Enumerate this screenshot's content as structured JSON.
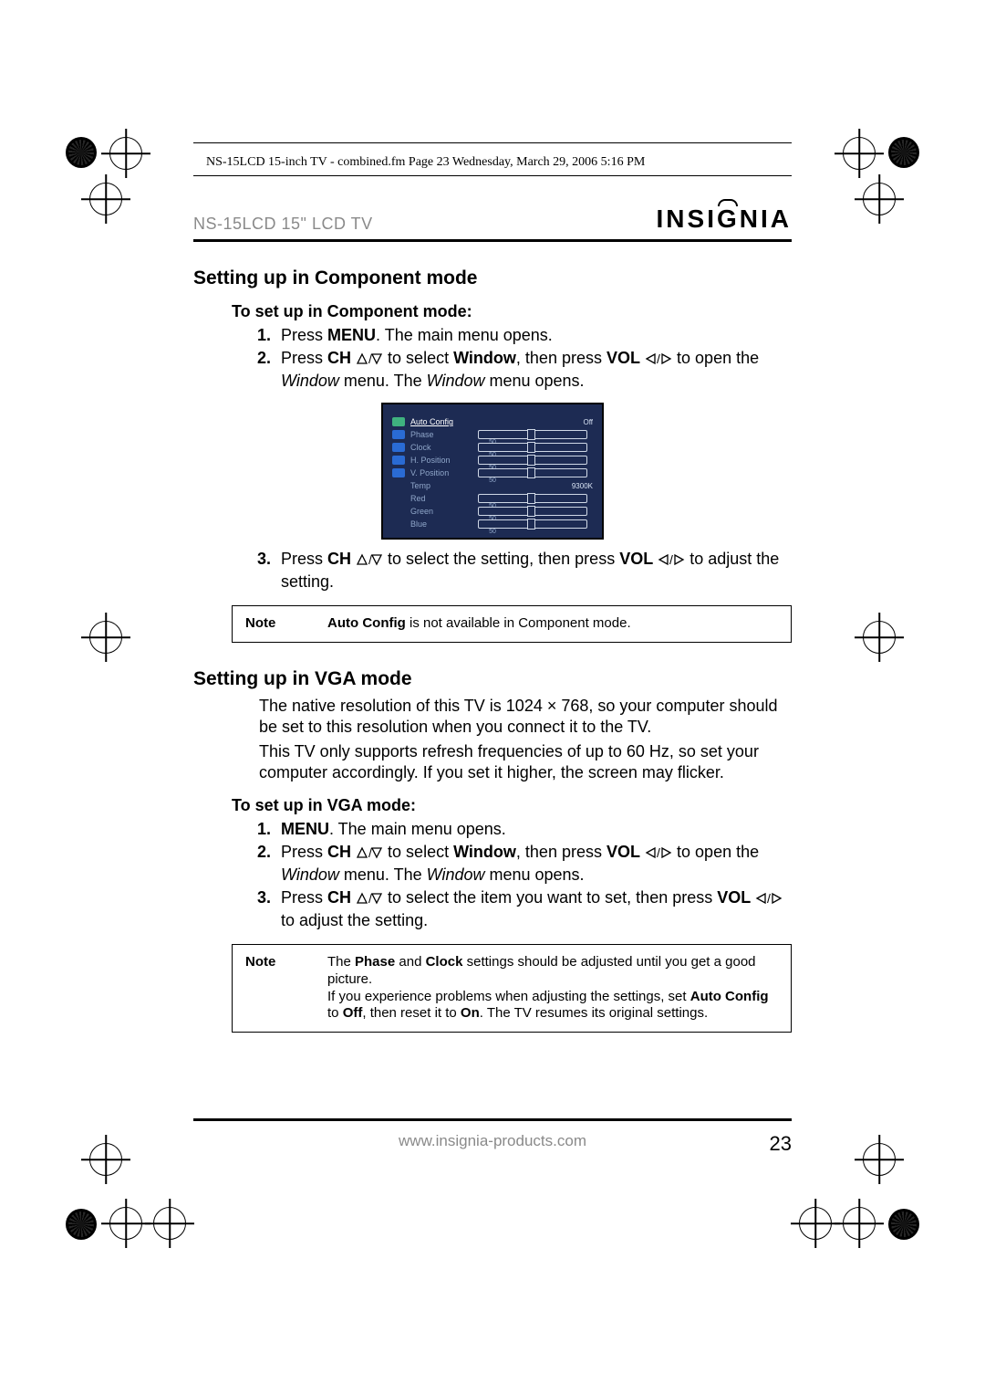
{
  "crop_header": "NS-15LCD 15-inch TV - combined.fm  Page 23  Wednesday, March 29, 2006  5:16 PM",
  "model": "NS-15LCD 15\" LCD TV",
  "brand_left": "INSI",
  "brand_mid": "G",
  "brand_right": "NIA",
  "h_component": "Setting up in Component mode",
  "s_component": "To set up in Component mode:",
  "comp_steps": {
    "s1a": "Press ",
    "s1b": "MENU",
    "s1c": ". The main menu opens.",
    "s2a": "Press ",
    "s2b": "CH",
    "s2c": " to select ",
    "s2d": "Window",
    "s2e": ", then press ",
    "s2f": "VOL",
    "s2g": " to open the ",
    "s2h": "Window",
    "s2i": " menu. The ",
    "s2j": "Window",
    "s2k": " menu opens.",
    "s3a": "Press ",
    "s3b": "CH",
    "s3c": " to select the setting, then press ",
    "s3d": "VOL",
    "s3e": " to adjust the setting."
  },
  "note1_label": "Note",
  "note1_b": "Auto Config",
  "note1_t": " is not available in Component mode.",
  "h_vga": "Setting up in VGA mode",
  "vga_p1": "The native resolution of this TV is 1024 × 768, so your computer should be set to this resolution when you connect it to the TV.",
  "vga_p2": "This TV only supports refresh frequencies of up to 60 Hz, so set your computer accordingly. If you set it higher, the screen may flicker.",
  "s_vga": "To set up in VGA mode:",
  "vga_steps": {
    "s1a": "MENU",
    "s1b": ". The main menu opens.",
    "s2a": "Press ",
    "s2b": "CH",
    "s2c": " to select ",
    "s2d": "Window",
    "s2e": ", then press ",
    "s2f": "VOL",
    "s2g": " to open the ",
    "s2h": "Window",
    "s2i": " menu. The ",
    "s2j": "Window",
    "s2k": " menu opens.",
    "s3a": "Press ",
    "s3b": "CH",
    "s3c": " to select the item you want to set, then press ",
    "s3d": "VOL",
    "s3e": " to adjust the setting."
  },
  "note2_label": "Note",
  "note2_a": "The ",
  "note2_b": "Phase",
  "note2_c": " and ",
  "note2_d": "Clock",
  "note2_e": " settings should be adjusted until you get a good picture.",
  "note2_f": "If you experience problems when adjusting the settings, set ",
  "note2_g": "Auto Config",
  "note2_h": " to ",
  "note2_i": "Off",
  "note2_j": ", then reset it to ",
  "note2_k": "On",
  "note2_l": ". The TV resumes its original settings.",
  "osd": {
    "rows": [
      {
        "icon": "#3fb27f",
        "label": "Auto Config",
        "value": "Off",
        "bar": false
      },
      {
        "icon": "#2a6bd4",
        "label": "Phase",
        "value": "50",
        "bar": true
      },
      {
        "icon": "#2a6bd4",
        "label": "Clock",
        "value": "50",
        "bar": true
      },
      {
        "icon": "#2a6bd4",
        "label": "H. Position",
        "value": "50",
        "bar": true
      },
      {
        "icon": "#2a6bd4",
        "label": "V. Position",
        "value": "50",
        "bar": true
      },
      {
        "icon": "",
        "label": "Temp",
        "value": "9300K",
        "bar": false
      },
      {
        "icon": "",
        "label": "Red",
        "value": "50",
        "bar": true
      },
      {
        "icon": "",
        "label": "Green",
        "value": "50",
        "bar": true
      },
      {
        "icon": "",
        "label": "Blue",
        "value": "50",
        "bar": true
      }
    ]
  },
  "footer_url": "www.insignia-products.com",
  "page_number": "23"
}
